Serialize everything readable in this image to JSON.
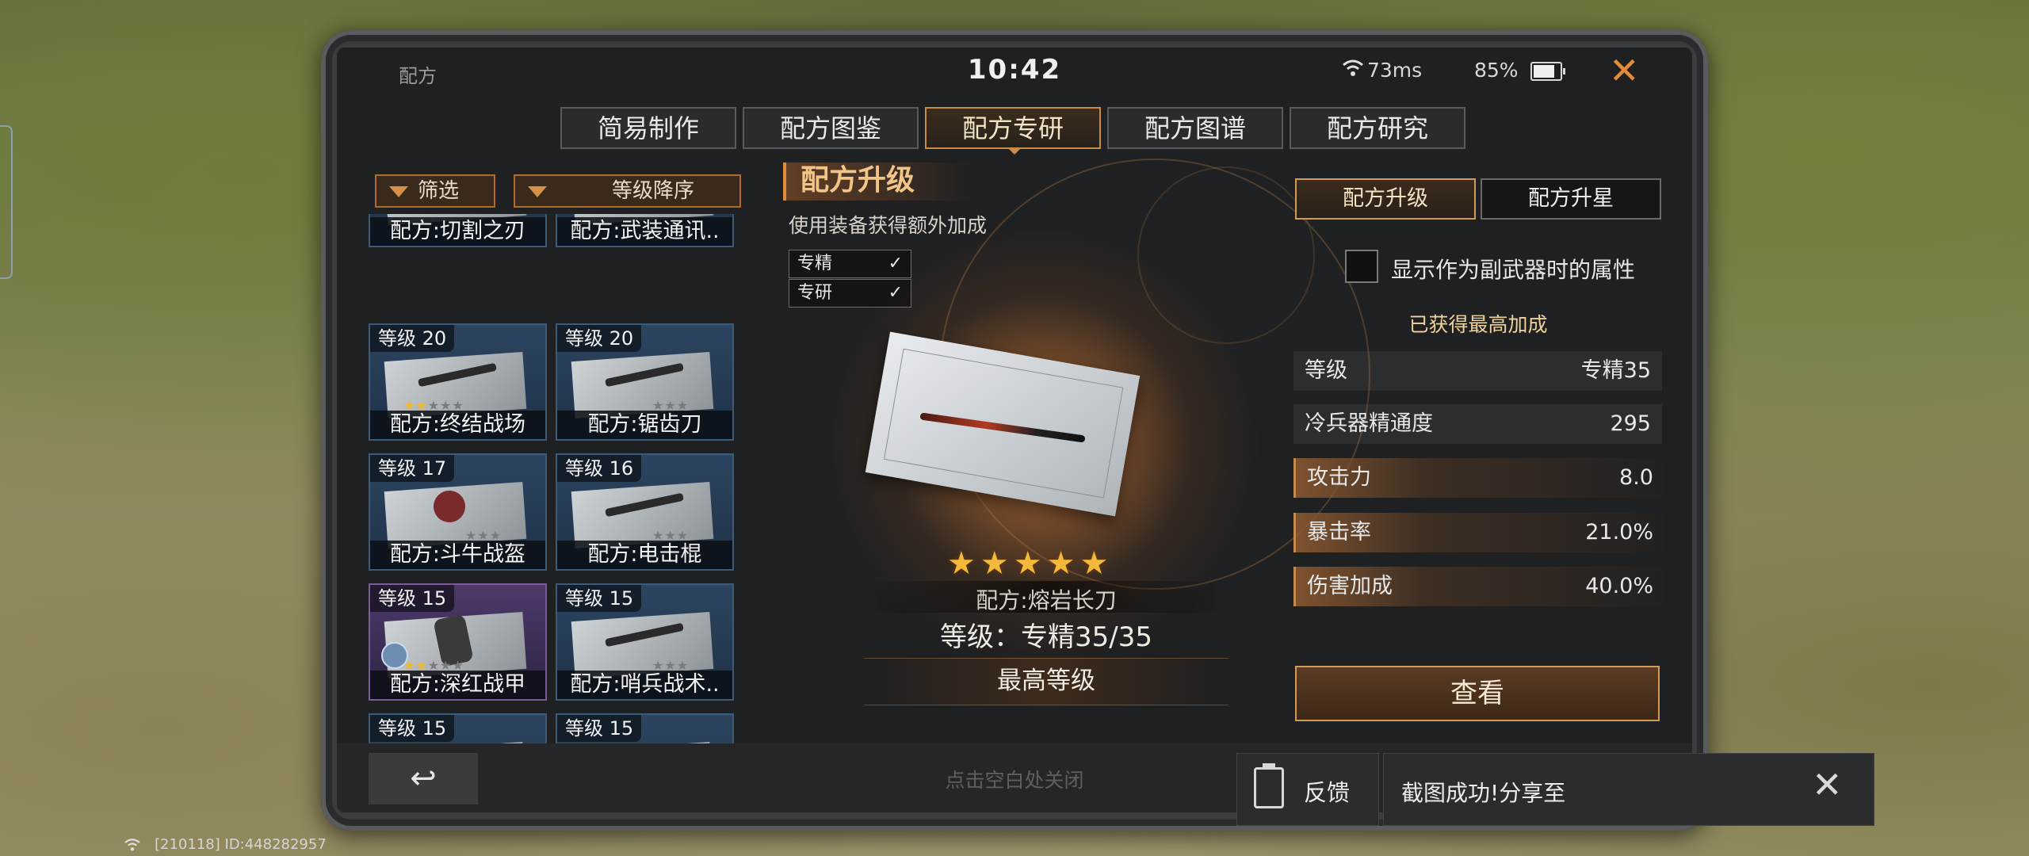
{
  "top": {
    "title": "配方",
    "clock": "10:42",
    "ping": "73ms",
    "battery": "85%",
    "close_icon": "close-icon"
  },
  "tabs": [
    {
      "label": "简易制作"
    },
    {
      "label": "配方图鉴"
    },
    {
      "label": "配方专研",
      "active": true
    },
    {
      "label": "配方图谱"
    },
    {
      "label": "配方研究"
    }
  ],
  "filters": {
    "filter_label": "筛选",
    "sort_label": "等级降序"
  },
  "cards": [
    {
      "level": "",
      "name": "配方:切割之刃"
    },
    {
      "level": "",
      "name": "配方:武装通讯.."
    },
    {
      "level": "等级 20",
      "name": "配方:终结战场"
    },
    {
      "level": "等级 20",
      "name": "配方:锯齿刀"
    },
    {
      "level": "等级 17",
      "name": "配方:斗牛战盔"
    },
    {
      "level": "等级 16",
      "name": "配方:电击棍"
    },
    {
      "level": "等级 15",
      "name": "配方:深红战甲"
    },
    {
      "level": "等级 15",
      "name": "配方:哨兵战术.."
    },
    {
      "level": "等级 15",
      "name": ""
    },
    {
      "level": "等级 15",
      "name": ""
    }
  ],
  "middle": {
    "title": "配方升级",
    "subtitle": "使用装备获得额外加成",
    "checks": [
      {
        "label": "专精",
        "mark": "✓"
      },
      {
        "label": "专研",
        "mark": "✓"
      }
    ],
    "stars": "★★★★★",
    "weapon_name": "配方:熔岩长刀",
    "level_text": "等级：专精35/35",
    "max_level": "最高等级"
  },
  "right": {
    "tab_upgrade": "配方升级",
    "tab_star": "配方升星",
    "checkbox_label": "显示作为副武器时的属性",
    "max_bonus": "已获得最高加成",
    "stats": [
      {
        "key": "等级",
        "value": "专精35"
      },
      {
        "key": "冷兵器精通度",
        "value": "295"
      },
      {
        "key": "攻击力",
        "value": "8.0"
      },
      {
        "key": "暴击率",
        "value": "21.0%"
      },
      {
        "key": "伤害加成",
        "value": "40.0%"
      }
    ],
    "view_button": "查看"
  },
  "bottom": {
    "back_icon": "back-arrow-icon",
    "hint": "点击空白处关闭"
  },
  "overlay": {
    "feedback_label": "反馈",
    "share_label": "截图成功!分享至",
    "close_icon": "close-icon"
  },
  "footer_id": "[210118] ID:448282957",
  "colors": {
    "accent": "#e08c3a",
    "star": "#f4b83a",
    "card_blue": "#2c4560",
    "card_purple": "#4d3a6a"
  }
}
